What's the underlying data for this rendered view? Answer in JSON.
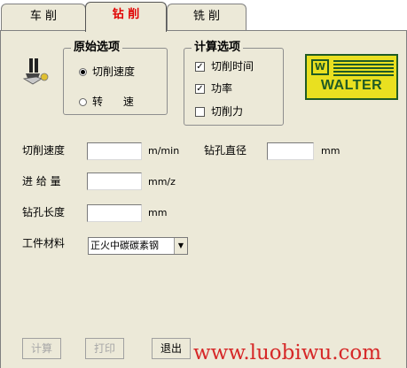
{
  "tabs": [
    {
      "label": "车  削",
      "active": false
    },
    {
      "label": "钻  削",
      "active": true
    },
    {
      "label": "铣  削",
      "active": false
    }
  ],
  "original_options": {
    "title": "原始选项",
    "items": [
      {
        "label": "切削速度",
        "selected": true
      },
      {
        "label": "转      速",
        "selected": false
      }
    ]
  },
  "calc_options": {
    "title": "计算选项",
    "items": [
      {
        "label": "切削时间",
        "checked": true
      },
      {
        "label": "功率",
        "checked": true
      },
      {
        "label": "切削力",
        "checked": false
      }
    ]
  },
  "logo": {
    "text": "WALTER",
    "mark": "W"
  },
  "fields": {
    "cutting_speed": {
      "label": "切削速度",
      "unit": "m/min",
      "value": ""
    },
    "drill_diameter": {
      "label": "钻孔直径",
      "unit": "mm",
      "value": ""
    },
    "feed": {
      "label": "进 给 量",
      "unit": "mm/z",
      "value": ""
    },
    "drill_length": {
      "label": "钻孔长度",
      "unit": "mm",
      "value": ""
    }
  },
  "material": {
    "label": "工件材料",
    "selected": "正火中碳碳素钢"
  },
  "buttons": {
    "calculate": "计算",
    "print": "打印",
    "exit": "退出"
  },
  "watermark": "www.luobiwu.com",
  "colors": {
    "active_tab": "#e00000",
    "panel": "#ece9d8",
    "logo_bg": "#e9e020",
    "logo_fg": "#1f5b25",
    "watermark": "#d62828"
  },
  "icons": {
    "tool": "drill-tool-icon",
    "check": "✓",
    "arrow": "▼"
  }
}
